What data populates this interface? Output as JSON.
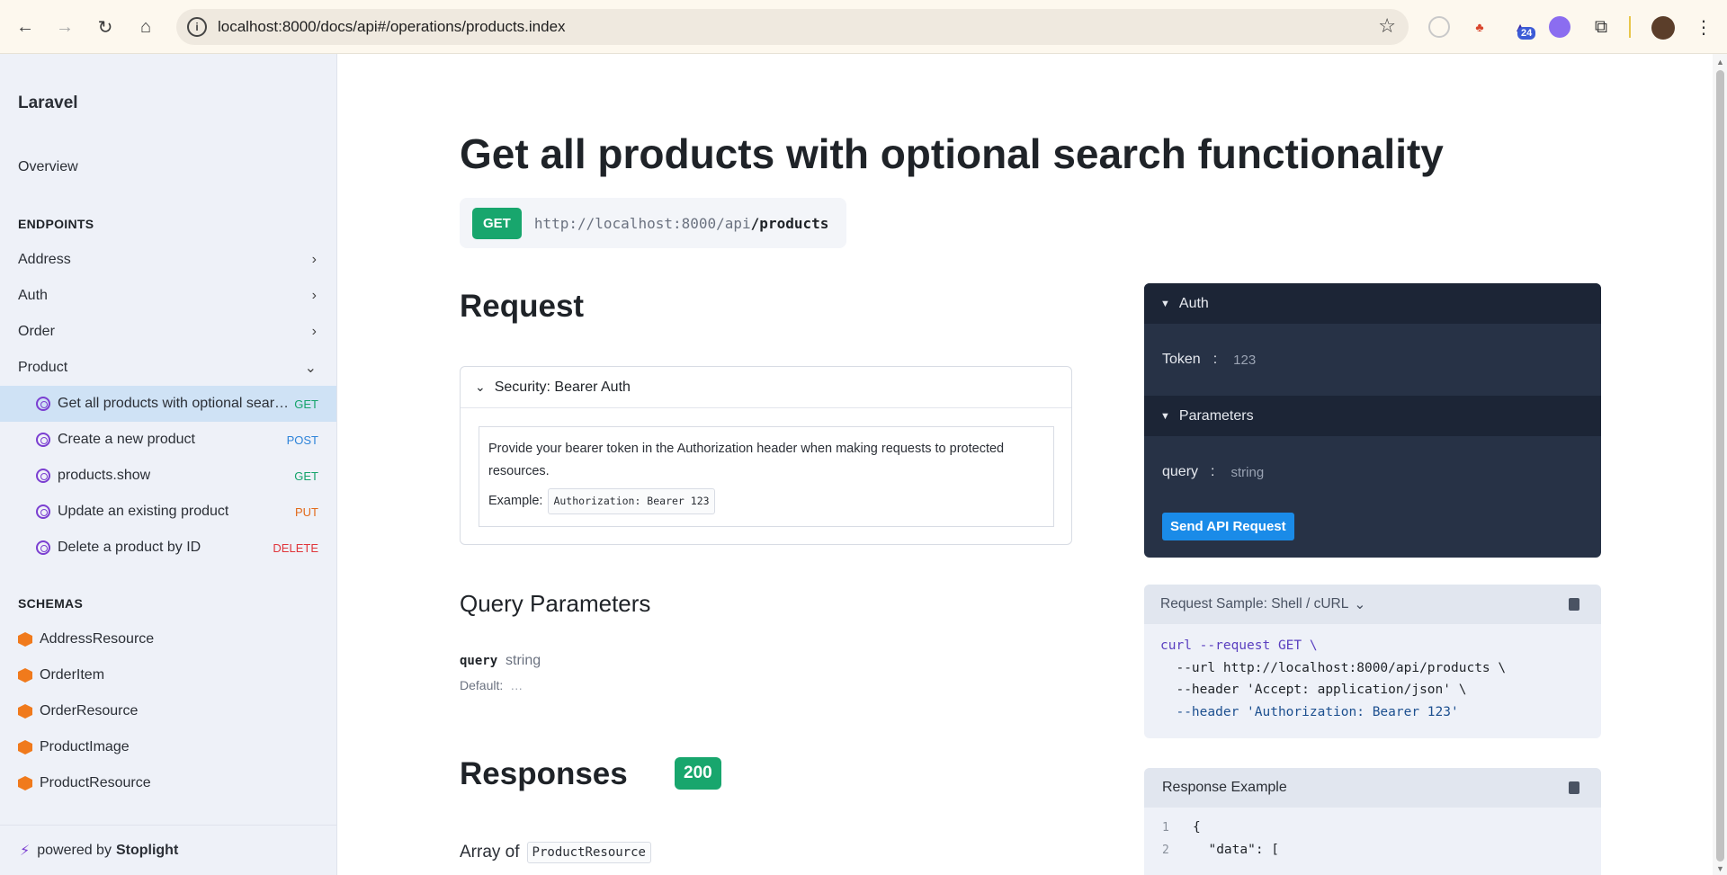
{
  "browser": {
    "url": "localhost:8000/docs/api#/operations/products.index",
    "extension_badge": "24"
  },
  "sidebar": {
    "title": "Laravel",
    "overview": "Overview",
    "endpoints_heading": "ENDPOINTS",
    "groups": [
      {
        "label": "Address"
      },
      {
        "label": "Auth"
      },
      {
        "label": "Order"
      },
      {
        "label": "Product"
      }
    ],
    "operations": [
      {
        "label": "Get all products with optional search functionality",
        "method": "GET"
      },
      {
        "label": "Create a new product",
        "method": "POST"
      },
      {
        "label": "products.show",
        "method": "GET"
      },
      {
        "label": "Update an existing product",
        "method": "PUT"
      },
      {
        "label": "Delete a product by ID",
        "method": "DELETE"
      }
    ],
    "schemas_heading": "SCHEMAS",
    "schemas": [
      {
        "label": "AddressResource"
      },
      {
        "label": "OrderItem"
      },
      {
        "label": "OrderResource"
      },
      {
        "label": "ProductImage"
      },
      {
        "label": "ProductResource"
      }
    ],
    "footer": {
      "prefix": "powered by",
      "brand": "Stoplight"
    }
  },
  "main": {
    "title": "Get all products with optional search functionality",
    "endpoint": {
      "method": "GET",
      "base": "http://localhost:8000/api",
      "path": "/products"
    },
    "request_heading": "Request",
    "security": {
      "title": "Security: Bearer Auth",
      "description": "Provide your bearer token in the Authorization header when making requests to protected resources.",
      "example_label": "Example:",
      "example_value": "Authorization: Bearer 123"
    },
    "query_params_heading": "Query Parameters",
    "query_param": {
      "name": "query",
      "type": "string",
      "default_label": "Default:",
      "default_value": "…"
    },
    "responses_heading": "Responses",
    "status_code": "200",
    "array_of_label": "Array of",
    "array_of_type": "ProductResource"
  },
  "try_it": {
    "auth_heading": "Auth",
    "token_label": "Token",
    "token_value": "123",
    "params_heading": "Parameters",
    "param_label": "query",
    "param_placeholder": "string",
    "send_button": "Send API Request"
  },
  "request_sample": {
    "title": "Request Sample: Shell / cURL",
    "lines": [
      "curl --request GET \\",
      "  --url http://localhost:8000/api/products \\",
      "  --header 'Accept: application/json' \\",
      "  --header 'Authorization: Bearer 123'"
    ]
  },
  "response_example": {
    "title": "Response Example",
    "lines": [
      {
        "n": "1",
        "code": "{"
      },
      {
        "n": "2",
        "code": "  \"data\": ["
      }
    ]
  },
  "colors": {
    "get": "#15a36b",
    "post": "#2e84d9",
    "put": "#e26a1b",
    "delete": "#e0353b",
    "accent": "#1a8be8"
  }
}
